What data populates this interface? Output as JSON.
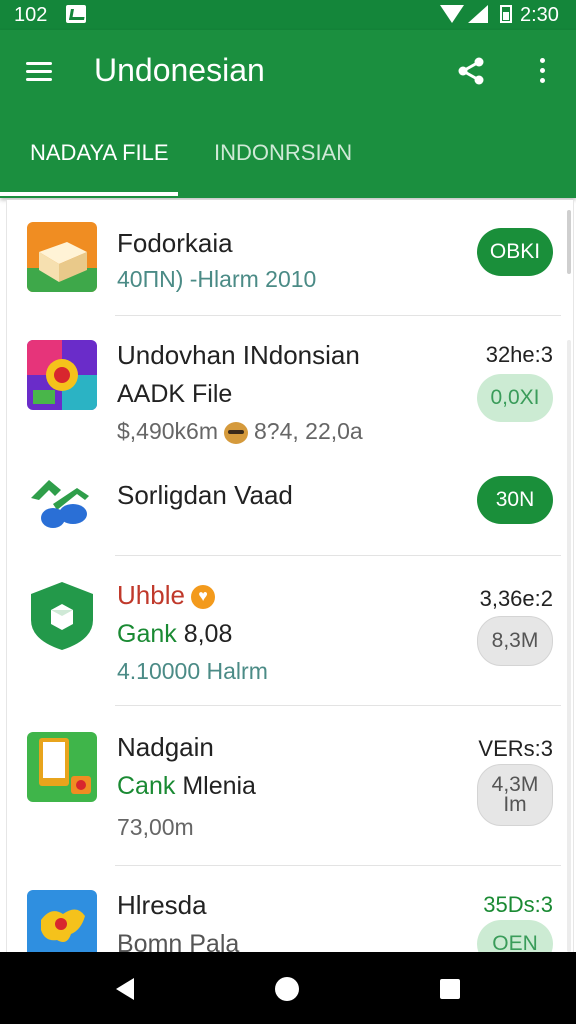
{
  "status_bar": {
    "time_left": "102",
    "time_right": "2:30"
  },
  "app_bar": {
    "title": "Undonesian",
    "menu_icon": "hamburger-menu-icon",
    "share_icon": "share-icon",
    "more_icon": "more-vert-icon"
  },
  "tabs": [
    {
      "label": "NADAYA FILE",
      "active": true
    },
    {
      "label": "INDONRSIAN",
      "active": false
    }
  ],
  "items": [
    {
      "title": "Fodorkaia",
      "subtitle": "",
      "meta": "40ПN) -Hlarm 2010",
      "right_meta": "",
      "button": "OBKI",
      "icon": "box-app-icon"
    },
    {
      "title": "Undovhan INdonsian",
      "subtitle": "AADK File",
      "meta_before": "$,490k6m",
      "meta_after": "8?4, 22,0a",
      "right_meta": "32he:3",
      "button": "0,0XI",
      "icon": "game-app-icon"
    },
    {
      "title": "Sorligdan Vaad",
      "subtitle": "",
      "meta": "",
      "right_meta": "",
      "button": "30N",
      "icon": "blue-green-logo-icon"
    },
    {
      "title": "Uhble",
      "subtitle_green": "Gank",
      "subtitle_rest": " 8,08",
      "meta": "4.10000 Halrm",
      "right_meta": "3,36e:2",
      "button": "8,3M",
      "icon": "green-shield-icon"
    },
    {
      "title": "Nadgain",
      "subtitle_green": "Cank",
      "subtitle_rest": " Mlenia",
      "meta": "73,00m",
      "right_meta": "VERs:3",
      "button": "4,3M\nIm",
      "icon": "phone-app-icon"
    },
    {
      "title": "Hlresda",
      "subtitle": "Bomn Pala",
      "meta": "",
      "right_meta": "35Ds:3",
      "button": "OEN",
      "icon": "map-app-icon"
    }
  ],
  "nav": {
    "back_icon": "back-triangle-icon",
    "home_icon": "home-circle-icon",
    "recents_icon": "recents-square-icon"
  },
  "colors": {
    "primary": "#1b8f3f",
    "status": "#14863a",
    "accent_orange": "#f39a1c",
    "title_red": "#c0392b"
  }
}
